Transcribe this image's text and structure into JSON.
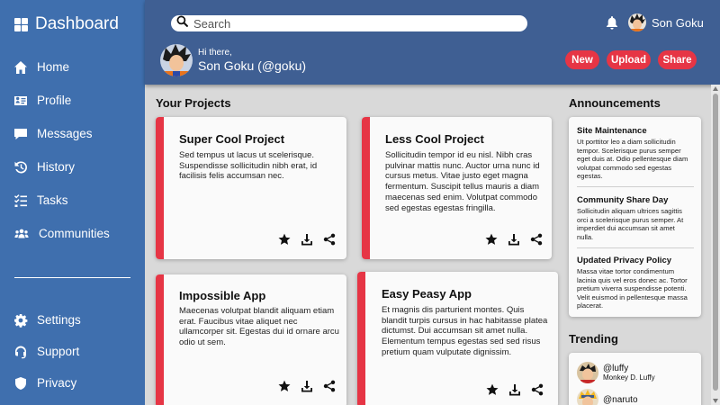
{
  "app": {
    "title": "Dashboard"
  },
  "sidebar": {
    "items": [
      {
        "label": "Home",
        "icon": "home-icon"
      },
      {
        "label": "Profile",
        "icon": "id-card-icon"
      },
      {
        "label": "Messages",
        "icon": "message-icon"
      },
      {
        "label": "History",
        "icon": "history-icon"
      },
      {
        "label": "Tasks",
        "icon": "tasks-icon"
      },
      {
        "label": "Communities",
        "icon": "users-icon"
      }
    ],
    "bottom_items": [
      {
        "label": "Settings",
        "icon": "gear-icon"
      },
      {
        "label": "Support",
        "icon": "headset-icon"
      },
      {
        "label": "Privacy",
        "icon": "shield-icon"
      }
    ]
  },
  "header": {
    "search_placeholder": "Search",
    "user_name": "Son Goku",
    "greeting": "Hi there,",
    "greeting_name": "Son Goku (@goku)",
    "buttons": {
      "new": "New",
      "upload": "Upload",
      "share": "Share"
    }
  },
  "projects": {
    "title": "Your Projects",
    "cards": [
      {
        "title": "Super Cool Project",
        "text": "Sed tempus ut lacus ut scelerisque. Suspendisse sollicitudin nibh erat, id facilisis felis accumsan nec."
      },
      {
        "title": "Less Cool Project",
        "text": "Sollicitudin tempor id eu nisl. Nibh cras pulvinar mattis nunc. Auctor urna nunc id cursus metus. Vitae justo eget magna fermentum. Suscipit tellus mauris a diam maecenas sed enim. Volutpat commodo sed egestas egestas fringilla."
      },
      {
        "title": "Impossible App",
        "text": "Maecenas volutpat blandit aliquam etiam erat. Faucibus vitae aliquet nec ullamcorper sit. Egestas dui id ornare arcu odio ut sem."
      },
      {
        "title": "Easy Peasy App",
        "text": "Et magnis dis parturient montes. Quis blandit turpis cursus in hac habitasse platea dictumst. Dui accumsan sit amet nulla. Elementum tempus egestas sed sed risus pretium quam vulputate dignissim."
      }
    ]
  },
  "announcements": {
    "title": "Announcements",
    "items": [
      {
        "title": "Site Maintenance",
        "text": "Ut porttitor leo a diam sollicitudin tempor. Scelerisque purus semper eget duis at. Odio pellentesque diam volutpat commodo sed egestas egestas."
      },
      {
        "title": "Community Share Day",
        "text": "Sollicitudin aliquam ultrices sagittis orci a scelerisque purus semper. At imperdiet dui accumsan sit amet nulla."
      },
      {
        "title": "Updated Privacy Policy",
        "text": "Massa vitae tortor condimentum lacinia quis vel eros donec ac. Tortor pretium viverra suspendisse potenti. Velit euismod in pellentesque massa placerat."
      }
    ]
  },
  "trending": {
    "title": "Trending",
    "items": [
      {
        "handle": "@luffy",
        "name": "Monkey D. Luffy"
      },
      {
        "handle": "@naruto",
        "name": ""
      }
    ]
  },
  "colors": {
    "sidebar": "#3f6fae",
    "header": "#3f5f93",
    "accent": "#e63545",
    "background": "#d9d9d9"
  }
}
